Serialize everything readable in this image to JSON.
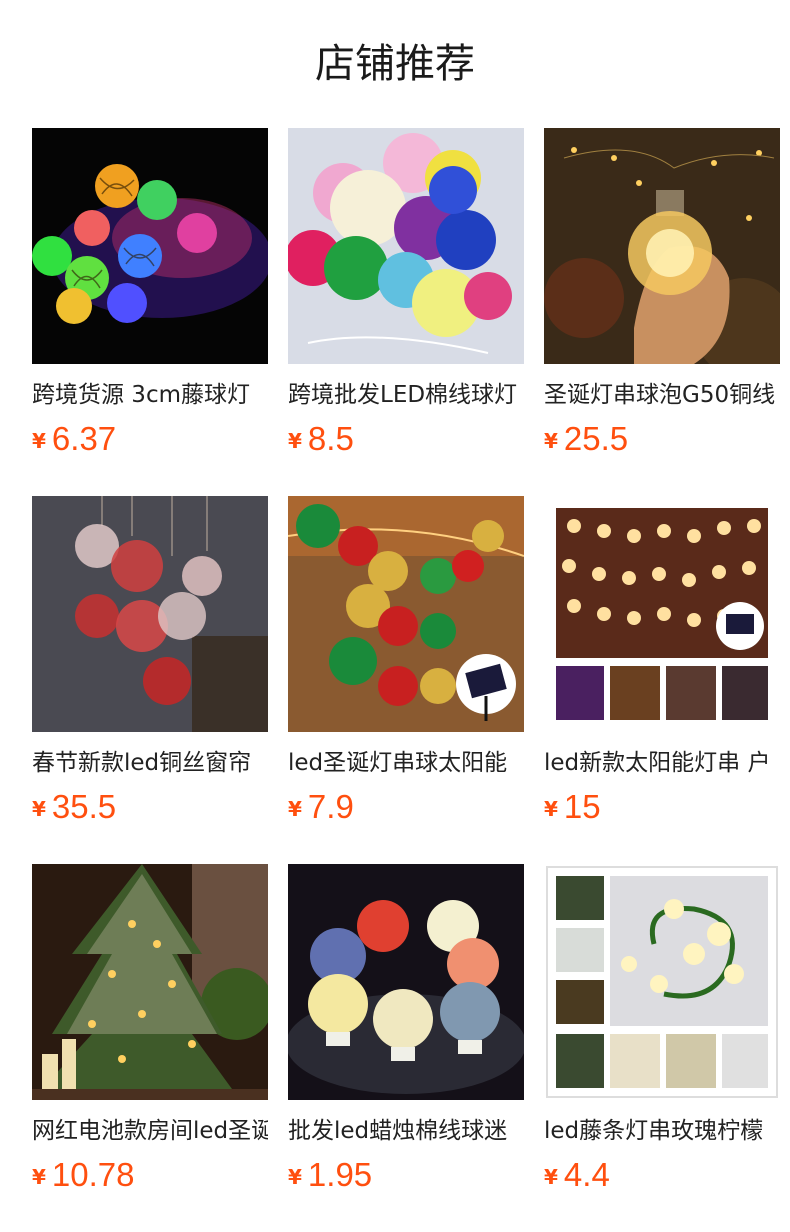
{
  "header": {
    "title": "店铺推荐"
  },
  "products": [
    {
      "name": "跨境货源 3cm藤球灯",
      "currency": "¥",
      "price": "6.37",
      "image_icon": "rattan-ball-lights-image"
    },
    {
      "name": "跨境批发LED棉线球灯",
      "currency": "¥",
      "price": "8.5",
      "image_icon": "cotton-ball-lights-image"
    },
    {
      "name": "圣诞灯串球泡G50铜线",
      "currency": "¥",
      "price": "25.5",
      "image_icon": "bulb-in-hand-image"
    },
    {
      "name": "春节新款led铜丝窗帘",
      "currency": "¥",
      "price": "35.5",
      "image_icon": "hanging-globe-lights-image"
    },
    {
      "name": "led圣诞灯串球太阳能",
      "currency": "¥",
      "price": "7.9",
      "image_icon": "christmas-ball-lights-image"
    },
    {
      "name": "led新款太阳能灯串 户",
      "currency": "¥",
      "price": "15",
      "image_icon": "solar-bubble-lights-image"
    },
    {
      "name": "网红电池款房间led圣诞",
      "currency": "¥",
      "price": "10.78",
      "image_icon": "christmas-tree-image"
    },
    {
      "name": "批发led蜡烛棉线球迷",
      "currency": "¥",
      "price": "1.95",
      "image_icon": "candle-ball-lamps-image"
    },
    {
      "name": "led藤条灯串玫瑰柠檬",
      "currency": "¥",
      "price": "4.4",
      "image_icon": "rose-vine-lights-image"
    }
  ]
}
